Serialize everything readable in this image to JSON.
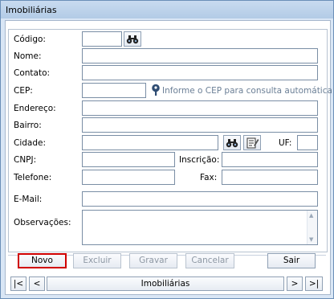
{
  "window": {
    "title": "Imobiliárias"
  },
  "form": {
    "codigo_label": "Código:",
    "nome_label": "Nome:",
    "contato_label": "Contato:",
    "cep_label": "CEP:",
    "cep_hint": "Informe o CEP para consulta automática",
    "endereco_label": "Endereço:",
    "bairro_label": "Bairro:",
    "cidade_label": "Cidade:",
    "uf_label": "UF:",
    "cnpj_label": "CNPJ:",
    "inscricao_label": "Inscrição:",
    "telefone_label": "Telefone:",
    "fax_label": "Fax:",
    "email_label": "E-Mail:",
    "observacoes_label": "Observações:"
  },
  "values": {
    "codigo": "",
    "nome": "",
    "contato": "",
    "cep": "",
    "endereco": "",
    "bairro": "",
    "cidade": "",
    "uf": "",
    "cnpj": "",
    "inscricao": "",
    "telefone": "",
    "fax": "",
    "email": "",
    "observacoes": ""
  },
  "buttons": {
    "novo": "Novo",
    "excluir": "Excluir",
    "gravar": "Gravar",
    "cancelar": "Cancelar",
    "sair": "Sair"
  },
  "navigator": {
    "first": "|<",
    "prev": "<",
    "caption": "Imobiliárias",
    "next": ">",
    "last": ">|"
  },
  "icons": {
    "search": "binoculars-icon",
    "notepad": "notepad-icon",
    "info": "info-pin-icon"
  },
  "colors": {
    "focus_border": "#d00000",
    "hint_text": "#6b7f96"
  }
}
